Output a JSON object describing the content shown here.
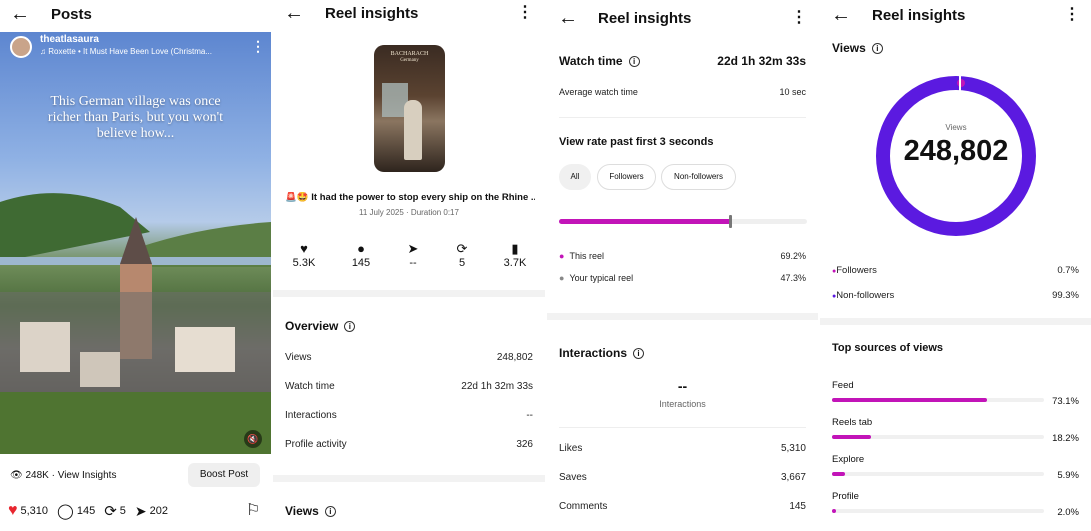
{
  "colors": {
    "accent": "#c214b8",
    "ring": "#5b1ae0",
    "like": "#e8262f"
  },
  "posts": {
    "title": "Posts",
    "username": "theatlasaura",
    "music": "Roxette • It Must Have Been Love (Christma...",
    "caption_overlay": "This German village was once richer than Paris, but you won't believe how...",
    "views_link": "248K · View Insights",
    "boost_label": "Boost Post",
    "likes": "5,310",
    "comments": "145",
    "reposts": "5",
    "shares": "202"
  },
  "reel": {
    "title": "Reel insights",
    "thumb_text_1": "BACHARACH",
    "thumb_text_2": "Germany",
    "caption": "🚨🤩 It had the power to stop every ship on the Rhine ...",
    "meta": "11 July 2025 · Duration 0:17",
    "stats": [
      {
        "icon": "heart-icon",
        "value": "5.3K"
      },
      {
        "icon": "comment-icon",
        "value": "145"
      },
      {
        "icon": "send-icon",
        "value": "--"
      },
      {
        "icon": "repost-icon",
        "value": "5"
      },
      {
        "icon": "bookmark-icon",
        "value": "3.7K"
      }
    ],
    "overview_title": "Overview",
    "overview": [
      {
        "label": "Views",
        "value": "248,802"
      },
      {
        "label": "Watch time",
        "value": "22d 1h 32m 33s"
      },
      {
        "label": "Interactions",
        "value": "--"
      },
      {
        "label": "Profile activity",
        "value": "326"
      }
    ],
    "views_title": "Views"
  },
  "watch": {
    "title": "Reel insights",
    "watch_time_label": "Watch time",
    "watch_time_value": "22d 1h 32m 33s",
    "avg_label": "Average watch time",
    "avg_value": "10 sec",
    "view_rate_title": "View rate past first 3 seconds",
    "filters": [
      "All",
      "Followers",
      "Non-followers"
    ],
    "this_reel_label": "This reel",
    "this_reel_value": "69.2%",
    "this_reel_fraction": 0.692,
    "typical_label": "Your typical reel",
    "typical_value": "47.3%",
    "typical_fraction": 0.473,
    "interactions_title": "Interactions",
    "interactions_value": "--",
    "interactions_caption": "Interactions",
    "rows": [
      {
        "label": "Likes",
        "value": "5,310"
      },
      {
        "label": "Saves",
        "value": "3,667"
      },
      {
        "label": "Comments",
        "value": "145"
      }
    ]
  },
  "views": {
    "title": "Reel insights",
    "section_title": "Views",
    "ring_label": "Views",
    "total": "248,802",
    "followers_label": "Followers",
    "followers_value": "0.7%",
    "nonfollowers_label": "Non-followers",
    "nonfollowers_value": "99.3%",
    "sources_title": "Top sources of views",
    "sources": [
      {
        "label": "Feed",
        "value": "73.1%",
        "fraction": 0.731
      },
      {
        "label": "Reels tab",
        "value": "18.2%",
        "fraction": 0.182
      },
      {
        "label": "Explore",
        "value": "5.9%",
        "fraction": 0.059
      },
      {
        "label": "Profile",
        "value": "2.0%",
        "fraction": 0.02
      }
    ]
  }
}
